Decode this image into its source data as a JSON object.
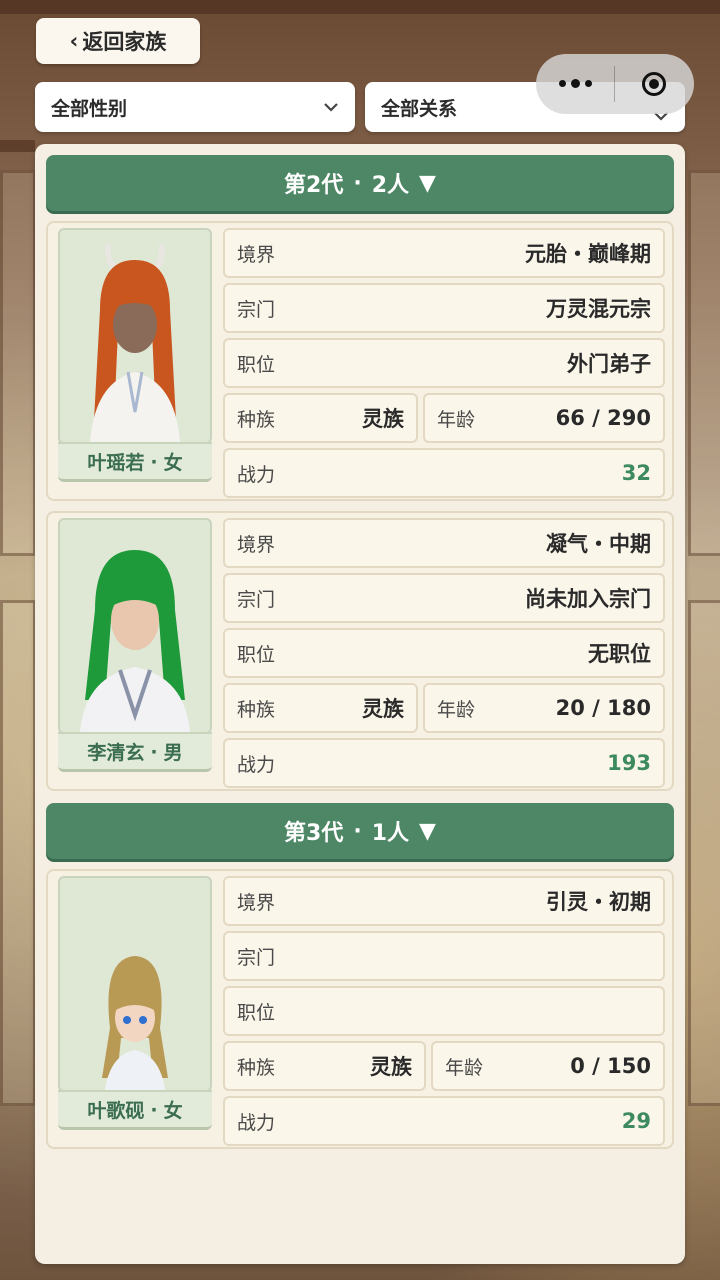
{
  "nav": {
    "back_label": "返回家族",
    "back_chevron": "‹"
  },
  "filters": {
    "gender": {
      "selected": "全部性别",
      "icon": "chevron-down-icon"
    },
    "relation": {
      "selected": "全部关系",
      "icon": "chevron-down-icon"
    }
  },
  "labels": {
    "realm": "境界",
    "sect": "宗门",
    "position": "职位",
    "race": "种族",
    "age": "年龄",
    "power": "战力",
    "dot": "·"
  },
  "generations": [
    {
      "title": "第2代",
      "count": "2人",
      "toggle": "▼",
      "members": [
        {
          "name": "叶瑶若",
          "gender": "女",
          "realm": "元胎・巅峰期",
          "sect": "万灵混元宗",
          "position": "外门弟子",
          "race": "灵族",
          "age": "66 / 290",
          "power": "32",
          "hair_color": "#c9551f"
        },
        {
          "name": "李清玄",
          "gender": "男",
          "realm": "凝气・中期",
          "sect": "尚未加入宗门",
          "position": "无职位",
          "race": "灵族",
          "age": "20 / 180",
          "power": "193",
          "hair_color": "#1e9a3a"
        }
      ]
    },
    {
      "title": "第3代",
      "count": "1人",
      "toggle": "▼",
      "members": [
        {
          "name": "叶歌砚",
          "gender": "女",
          "realm": "引灵・初期",
          "sect": "",
          "position": "",
          "race": "灵族",
          "age": "0 / 150",
          "power": "29",
          "hair_color": "#b89a55"
        }
      ]
    }
  ],
  "colors": {
    "header_green": "#4e8766",
    "power_green": "#3c8a5e",
    "name_green": "#3b6e51"
  }
}
